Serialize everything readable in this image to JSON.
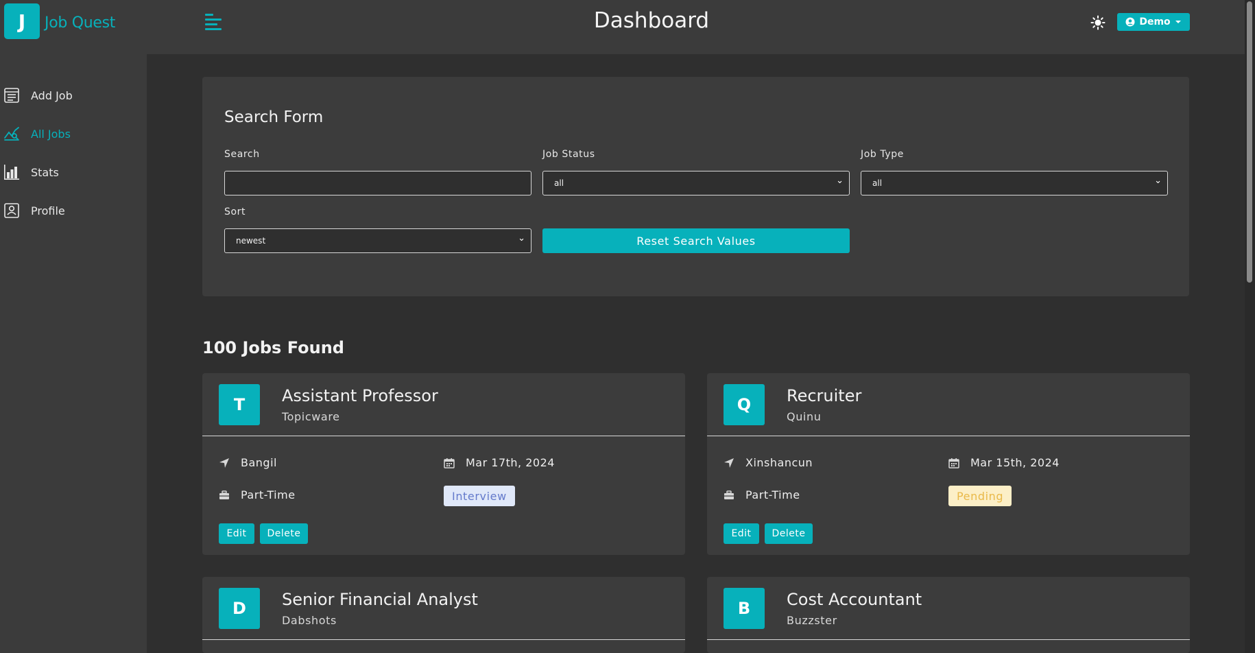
{
  "brand": {
    "logo_letter": "J",
    "name": "Job Quest"
  },
  "header": {
    "title": "Dashboard",
    "user_label": "Demo"
  },
  "sidebar": {
    "items": [
      {
        "label": "Add Job",
        "icon": "add-job-icon",
        "active": false
      },
      {
        "label": "All Jobs",
        "icon": "all-jobs-icon",
        "active": true
      },
      {
        "label": "Stats",
        "icon": "stats-icon",
        "active": false
      },
      {
        "label": "Profile",
        "icon": "profile-icon",
        "active": false
      }
    ]
  },
  "search_form": {
    "title": "Search Form",
    "search_label": "Search",
    "search_value": "",
    "status_label": "Job Status",
    "status_value": "all",
    "type_label": "Job Type",
    "type_value": "all",
    "sort_label": "Sort",
    "sort_value": "newest",
    "reset_label": "Reset Search Values"
  },
  "jobs_count": "100 Jobs Found",
  "jobs": [
    {
      "letter": "T",
      "title": "Assistant Professor",
      "company": "Topicware",
      "location": "Bangil",
      "date": "Mar 17th, 2024",
      "type": "Part-Time",
      "status": "Interview"
    },
    {
      "letter": "Q",
      "title": "Recruiter",
      "company": "Quinu",
      "location": "Xinshancun",
      "date": "Mar 15th, 2024",
      "type": "Part-Time",
      "status": "Pending"
    },
    {
      "letter": "D",
      "title": "Senior Financial Analyst",
      "company": "Dabshots"
    },
    {
      "letter": "B",
      "title": "Cost Accountant",
      "company": "Buzzster"
    }
  ],
  "actions": {
    "edit": "Edit",
    "delete": "Delete"
  },
  "colors": {
    "accent": "#07b1bb",
    "background": "#2f2f2f",
    "panel": "#3c3c3c",
    "interview": "#647acb",
    "pending": "#e9b949"
  }
}
